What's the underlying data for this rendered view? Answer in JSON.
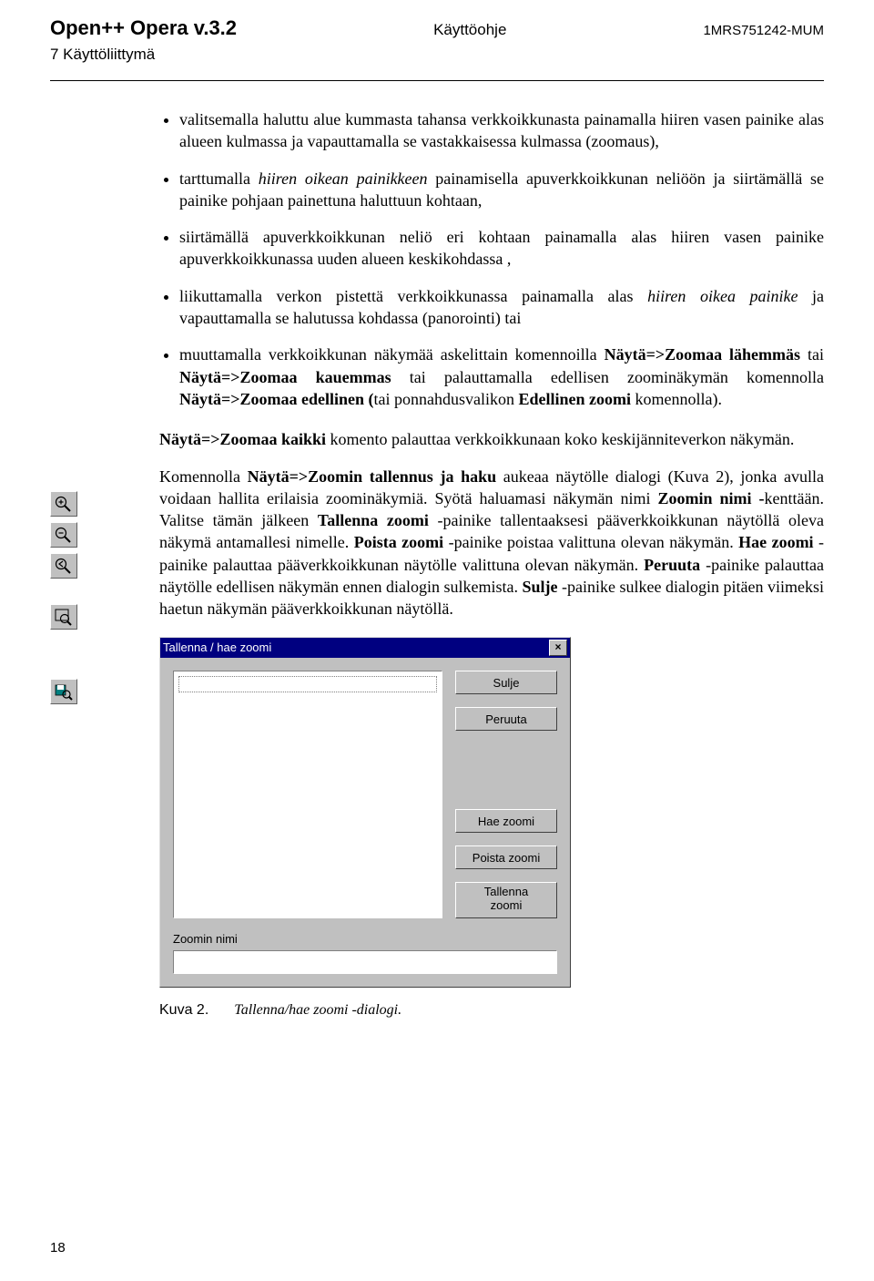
{
  "header": {
    "left": "Open++ Opera v.3.2",
    "center": "Käyttöohje",
    "right": "1MRS751242-MUM",
    "sub": "7 Käyttöliittymä"
  },
  "bullets": [
    {
      "pre": "valitsemalla haluttu alue kummasta tahansa verkkoikkunasta painamalla hiiren vasen painike alas alueen kulmassa ja vapauttamalla se vastakkaisessa kulmassa (zoomaus),"
    },
    {
      "pre": "tarttumalla ",
      "it1": "hiiren oikean painikkeen",
      "post": " painamisella apuverkkoikkunan neliöön ja siirtämällä se painike pohjaan painettuna haluttuun kohtaan,"
    },
    {
      "pre": "siirtämällä apuverkkoikkunan neliö eri kohtaan painamalla alas hiiren vasen painike apuverkkoikkunassa uuden alueen keskikohdassa ,"
    },
    {
      "pre": "liikuttamalla verkon pistettä verkkoikkunassa painamalla alas ",
      "it1": "hiiren oikea painike",
      "post": " ja vapauttamalla se halutussa kohdassa (panorointi) tai"
    },
    {
      "pre": "muuttamalla verkkoikkunan näkymää askelittain komennoilla ",
      "b1": "Näytä=>Zoomaa lähemmäs",
      "mid1": " tai ",
      "b2": "Näytä=>Zoomaa kauemmas",
      "mid2": " tai palauttamalla edellisen zoominäkymän komennolla ",
      "b3": "Näytä=>Zoomaa edellinen (",
      "mid3": "tai ponnahdusvalikon ",
      "b4": "Edellinen zoomi",
      "post": " komennolla)."
    }
  ],
  "p1": {
    "b1": "Näytä=>Zoomaa kaikki",
    "rest": " komento palauttaa verkkoikkunaan koko keskijänniteverkon näkymän."
  },
  "p2": {
    "pre": "Komennolla ",
    "b1": "Näytä=>Zoomin tallennus ja haku",
    "mid1": " aukeaa näytölle dialogi (Kuva 2), jonka avulla voidaan hallita erilaisia zoominäkymiä. Syötä haluamasi näkymän nimi ",
    "b2": "Zoomin nimi -",
    "mid2": "kenttään. Valitse tämän jälkeen ",
    "b3": "Tallenna zoomi",
    "mid3": " -painike tallentaaksesi pääverkkoikkunan näytöllä oleva näkymä antamallesi nimelle. ",
    "b4": "Poista zoomi",
    "mid4": " -painike poistaa valittuna olevan näkymän. ",
    "b5": "Hae zoomi",
    "mid5": " -painike palauttaa pääverkkoikkunan näytölle valittuna olevan näkymän. ",
    "b6": "Peruuta",
    "mid6": " -painike palauttaa näytölle edellisen näkymän ennen dialogin sulkemista. ",
    "b7": "Sulje",
    "post": " -painike sulkee dialogin pitäen viimeksi haetun näkymän pääverkkoikkunan näytöllä."
  },
  "dialog": {
    "title": "Tallenna / hae zoomi",
    "close": "×",
    "buttons": {
      "close": "Sulje",
      "cancel": "Peruuta",
      "get": "Hae zoomi",
      "delete": "Poista zoomi",
      "save": "Tallenna\nzoomi"
    },
    "label": "Zoomin nimi"
  },
  "figure": {
    "num": "Kuva 2.",
    "caption": "Tallenna/hae zoomi -dialogi."
  },
  "pagenum": "18",
  "icons": {
    "zoom_in": "zoom-in",
    "zoom_out": "zoom-out",
    "zoom_prev": "zoom-prev",
    "zoom_all": "zoom-all",
    "zoom_save": "zoom-save"
  }
}
